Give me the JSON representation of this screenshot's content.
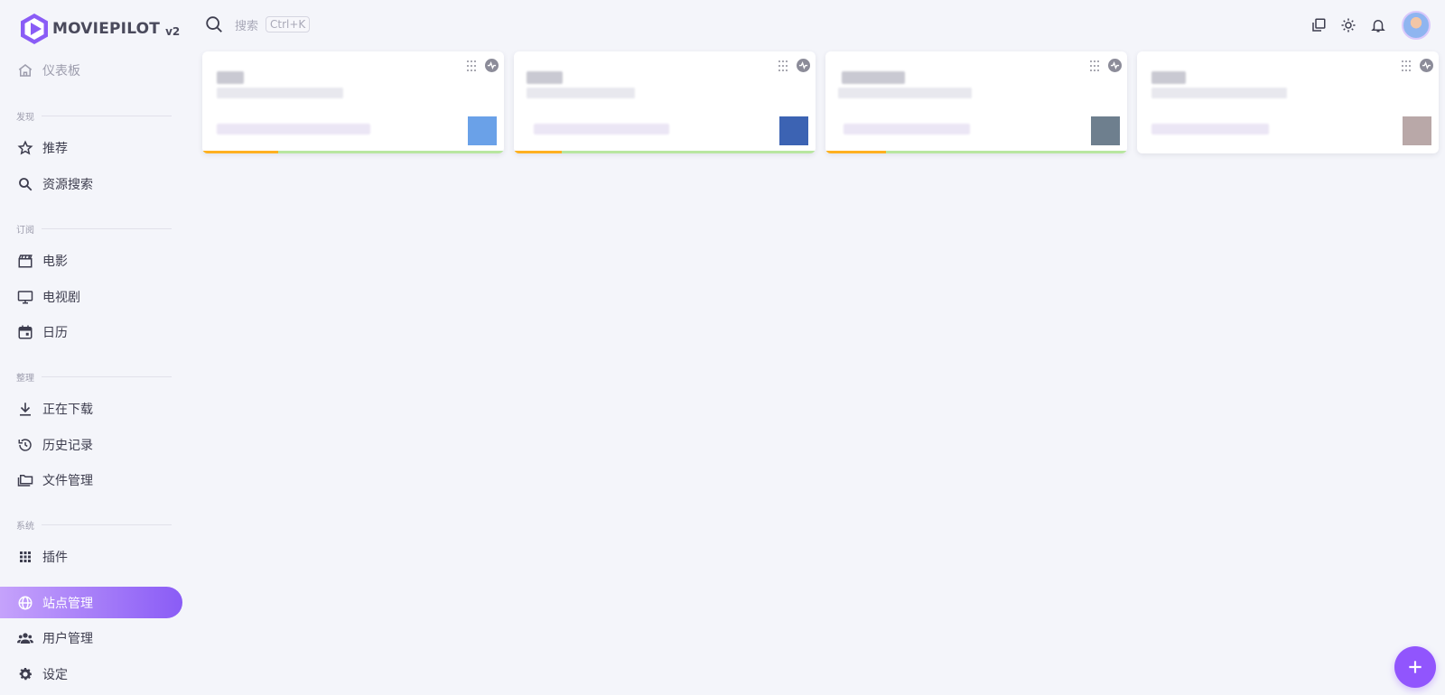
{
  "app": {
    "name": "MOVIEPILOT",
    "version": "v2"
  },
  "search": {
    "placeholder": "搜索",
    "shortcut": "Ctrl+K"
  },
  "sidebar": {
    "dashboard": {
      "label": "仪表板",
      "icon": "home-icon"
    },
    "sections": [
      {
        "title": "发现",
        "items": [
          {
            "label": "推荐",
            "icon": "star-icon"
          },
          {
            "label": "资源搜索",
            "icon": "search-icon"
          }
        ]
      },
      {
        "title": "订阅",
        "items": [
          {
            "label": "电影",
            "icon": "clapperboard-icon"
          },
          {
            "label": "电视剧",
            "icon": "tv-icon"
          },
          {
            "label": "日历",
            "icon": "calendar-icon"
          }
        ]
      },
      {
        "title": "整理",
        "items": [
          {
            "label": "正在下载",
            "icon": "download-icon"
          },
          {
            "label": "历史记录",
            "icon": "history-icon"
          },
          {
            "label": "文件管理",
            "icon": "folder-icon"
          }
        ]
      },
      {
        "title": "系统",
        "items": [
          {
            "label": "插件",
            "icon": "apps-icon"
          },
          {
            "label": "站点管理",
            "icon": "globe-icon",
            "active": true
          },
          {
            "label": "用户管理",
            "icon": "users-icon"
          },
          {
            "label": "设定",
            "icon": "gear-icon"
          }
        ]
      }
    ]
  },
  "topbar": {
    "icons": [
      "copy-icon",
      "theme-icon",
      "bell-icon"
    ],
    "avatar": "avatar"
  },
  "cards": [
    {
      "progress": 0.25,
      "pixel_color": "#6aa1e8"
    },
    {
      "progress": 0.16,
      "pixel_color": "#3c63b3"
    },
    {
      "progress": 0.2,
      "pixel_color": "#6e7f8e"
    },
    {
      "progress": 0.0,
      "pixel_color": "#b9a8a8"
    }
  ],
  "fab": {
    "icon": "plus-icon"
  },
  "colors": {
    "accent": "#9155fd",
    "progress_used": "#ffb020",
    "progress_rest": "#b8e6a0"
  }
}
